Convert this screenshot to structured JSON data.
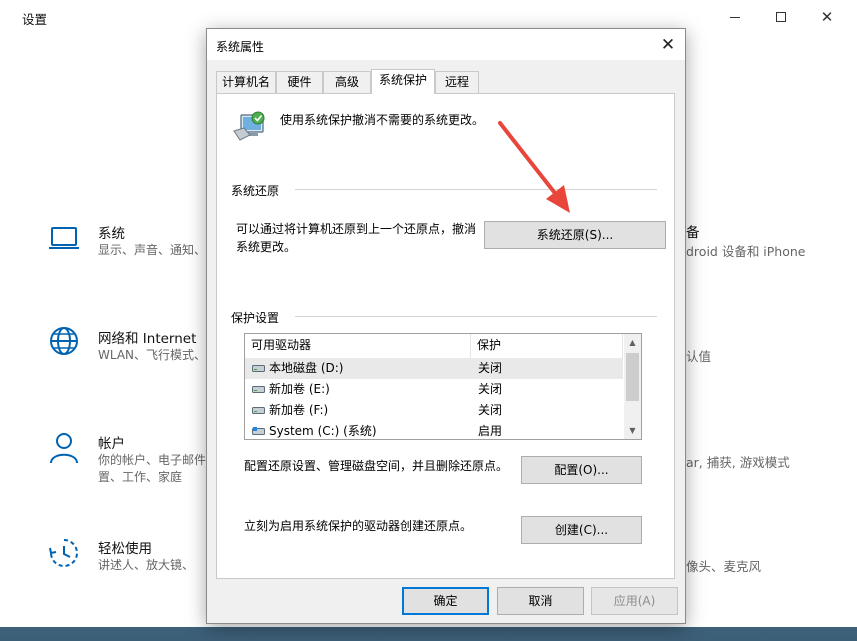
{
  "settings": {
    "title": "设置",
    "categories": [
      {
        "icon": "laptop-icon",
        "name": "系统",
        "desc": "显示、声音、通知、"
      },
      {
        "icon": "globe-icon",
        "name": "网络和 Internet",
        "desc": "WLAN、飞行模式、"
      },
      {
        "icon": "person-icon",
        "name": "帐户",
        "desc": "你的帐户、电子邮件",
        "desc2": "置、工作、家庭"
      },
      {
        "icon": "ease-of-access-icon",
        "name": "轻松使用",
        "desc": "讲述人、放大镜、"
      }
    ],
    "right_fragments": {
      "devices_name": "备",
      "devices_desc": "droid 设备和 iPhone",
      "personal": "认值",
      "gaming": "ar, 捕获, 游戏模式",
      "privacy": "像头、麦克风"
    }
  },
  "dialog": {
    "title": "系统属性",
    "close": "✕",
    "tabs": [
      "计算机名",
      "硬件",
      "高级",
      "系统保护",
      "远程"
    ],
    "active_tab": "系统保护",
    "intro": "使用系统保护撤消不需要的系统更改。",
    "restore_group": "系统还原",
    "restore_desc": "可以通过将计算机还原到上一个还原点，撤消系统更改。",
    "restore_button": "系统还原(S)...",
    "protection_group": "保护设置",
    "table": {
      "headers": [
        "可用驱动器",
        "保护"
      ],
      "rows": [
        {
          "drive": "本地磁盘 (D:)",
          "protection": "关闭",
          "icon": "hard-drive-icon"
        },
        {
          "drive": "新加卷 (E:)",
          "protection": "关闭",
          "icon": "hard-drive-icon"
        },
        {
          "drive": "新加卷 (F:)",
          "protection": "关闭",
          "icon": "hard-drive-icon"
        },
        {
          "drive": "System (C:) (系统)",
          "protection": "启用",
          "icon": "system-drive-icon"
        }
      ]
    },
    "config_text": "配置还原设置、管理磁盘空间，并且删除还原点。",
    "config_button": "配置(O)...",
    "create_text": "立刻为启用系统保护的驱动器创建还原点。",
    "create_button": "创建(C)...",
    "ok_button": "确定",
    "cancel_button": "取消",
    "apply_button": "应用(A)"
  },
  "colors": {
    "annotation_arrow": "#e8463a",
    "primary_border": "#0078d7",
    "settings_icon": "#0063b1"
  }
}
